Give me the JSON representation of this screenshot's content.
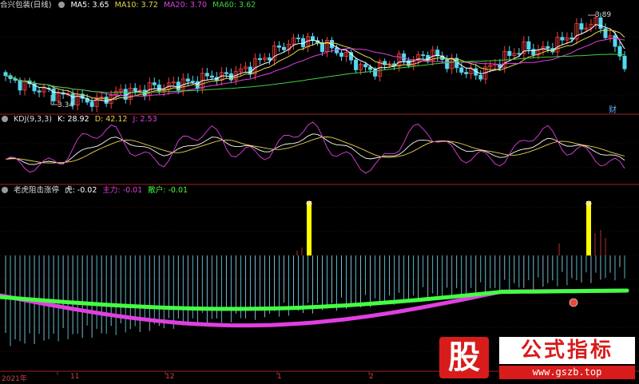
{
  "colors": {
    "bg": "#000000",
    "up": "#ff3b3b",
    "down": "#54d8f0",
    "grid": "#7a1515",
    "ma5": "#ffffff",
    "ma10": "#e8d44d",
    "ma20": "#e040e0",
    "ma60": "#40d040",
    "k": "#ffffff",
    "d": "#e8d44d",
    "j": "#e040e0",
    "tiger": "#ffffff",
    "main": "#e040e0",
    "retail": "#44ff44",
    "signal": "#ffff00"
  },
  "header": {
    "main": {
      "title": "合兴包装(日线)",
      "ma5": "MA5: 3.65",
      "ma10": "MA10: 3.72",
      "ma20": "MA20: 3.70",
      "ma60": "MA60: 3.62"
    },
    "kdj": {
      "title": "KDJ(9,3,3)",
      "k": "K: 28.92",
      "d": "D: 42.12",
      "j": "J: 2.53"
    },
    "ind": {
      "title": "老虎阻击涨停",
      "tiger": "虎: -0.02",
      "main_force": "主力: -0.01",
      "retail": "散户: -0.01"
    }
  },
  "annotations": {
    "high": "3.89",
    "low": "3.34",
    "cai": "财"
  },
  "x_axis": {
    "labels": [
      "2021年",
      "11",
      "12",
      "1",
      "2"
    ]
  },
  "watermark": {
    "logo": "股",
    "title": "公式指标",
    "url": "www.gszb.top"
  },
  "chart_data": [
    {
      "type": "candlestick",
      "title": "合兴包装(日线)",
      "price_range": [
        3.34,
        3.89
      ],
      "high_label": 3.89,
      "low_label": 3.34,
      "close_seed": [
        3.5,
        3.48,
        3.46,
        3.44,
        3.42,
        3.4,
        3.39,
        3.38,
        3.36,
        3.35,
        3.37,
        3.4,
        3.42,
        3.41,
        3.43,
        3.45,
        3.44,
        3.46,
        3.48,
        3.47,
        3.5,
        3.52,
        3.51,
        3.53,
        3.55,
        3.58,
        3.62,
        3.66,
        3.7,
        3.73,
        3.75,
        3.74,
        3.72,
        3.7,
        3.67,
        3.62,
        3.58,
        3.55,
        3.57,
        3.6,
        3.62,
        3.61,
        3.63,
        3.66,
        3.64,
        3.6,
        3.57,
        3.54,
        3.52,
        3.56,
        3.6,
        3.64,
        3.68,
        3.7,
        3.67,
        3.69,
        3.72,
        3.76,
        3.8,
        3.84,
        3.86,
        3.8,
        3.7,
        3.6
      ],
      "ma_values": {
        "MA5": 3.65,
        "MA10": 3.72,
        "MA20": 3.7,
        "MA60": 3.62
      }
    },
    {
      "type": "line",
      "title": "KDJ(9,3,3)",
      "series": [
        {
          "name": "K",
          "last": 28.92
        },
        {
          "name": "D",
          "last": 42.12
        },
        {
          "name": "J",
          "last": 2.53
        }
      ],
      "k_seed": [
        30,
        28,
        26,
        24,
        22,
        24,
        28,
        35,
        45,
        55,
        62,
        66,
        64,
        58,
        50,
        44,
        40,
        42,
        48,
        56,
        62,
        66,
        64,
        58,
        52,
        50,
        48,
        46,
        50,
        58,
        66,
        72,
        70,
        64,
        56,
        48,
        40,
        34,
        30,
        34,
        42,
        52,
        60,
        66,
        64,
        58,
        52,
        48,
        44,
        40,
        38,
        36,
        40,
        50,
        58,
        64,
        62,
        58,
        54,
        50,
        46,
        40,
        34,
        28
      ]
    },
    {
      "type": "bar",
      "title": "老虎阻击涨停",
      "series": [
        {
          "name": "虎",
          "last": -0.02
        },
        {
          "name": "主力",
          "last": -0.01
        },
        {
          "name": "散户",
          "last": -0.01
        }
      ],
      "signal_bars_index": [
        25,
        58
      ]
    }
  ]
}
